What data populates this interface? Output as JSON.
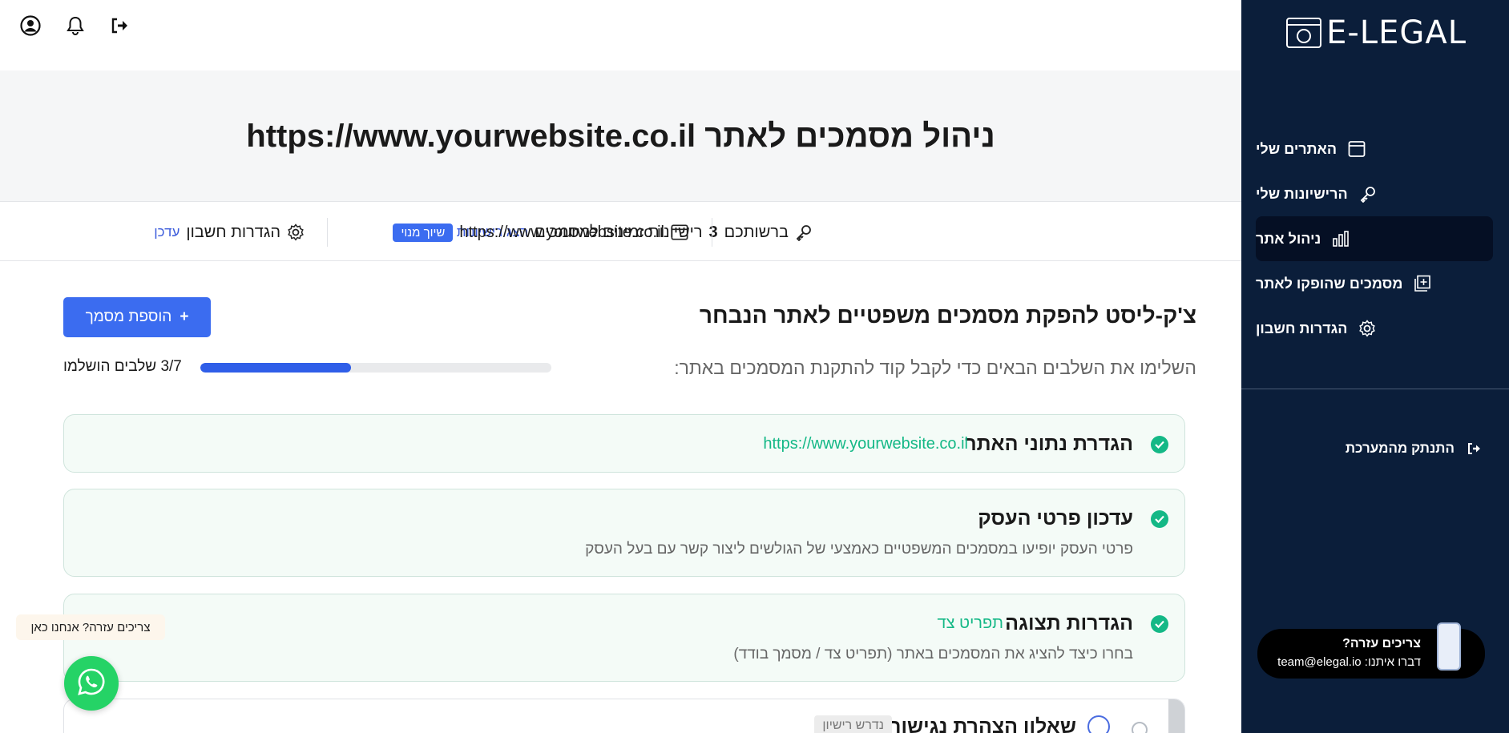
{
  "brand": {
    "logo_text": "E-LEGAL"
  },
  "sidebar": {
    "items": [
      {
        "label": "האתרים שלי",
        "icon": "browser-window-icon"
      },
      {
        "label": "הרישיונות שלי",
        "icon": "key-icon"
      },
      {
        "label": "ניהול אתר",
        "icon": "bar-chart-icon",
        "active": true
      },
      {
        "label": "מסמכים שהופקו לאתר",
        "icon": "document-plus-icon"
      },
      {
        "label": "הגדרות חשבון",
        "icon": "gear-icon"
      }
    ],
    "logout_label": "התנתק מהמערכת"
  },
  "help_card": {
    "title": "צריכים עזרה?",
    "email_line": "דברו איתנו: team@elegal.io"
  },
  "page": {
    "title": "ניהול מסמכים לאתר https://www.yourwebsite.co.il"
  },
  "info_row": {
    "licenses_prefix": "ברשותכם",
    "licenses_count": "3",
    "licenses_suffix": "רישיונות זמינים למסמכים",
    "show_licenses_link": "הצג רישיונות",
    "website_url": "https://www.yourwebsite.co.il",
    "assign_badge": "שיוך מנוי",
    "account_settings_label": "הגדרות חשבון",
    "update_link": "עדכן"
  },
  "checklist": {
    "title": "צ'ק-ליסט להפקת מסמכים משפטיים לאתר הנבחר",
    "subtitle": "השלימו את השלבים הבאים כדי לקבל קוד להתקנת המסמכים באתר:",
    "add_button_label": "הוספת מסמך",
    "progress_label": "3/7 שלבים הושלמו",
    "progress_fraction": 0.43,
    "steps": [
      {
        "title": "הגדרת נתוני האתר",
        "extra": "https://www.yourwebsite.co.il",
        "desc": ""
      },
      {
        "title": "עדכון פרטי העסק",
        "extra": "",
        "desc": "פרטי העסק יופיעו במסמכים המשפטיים כאמצעי של הגולשים ליצור קשר עם בעל העסק"
      },
      {
        "title": "הגדרות תצוגה",
        "extra": "תפריט צד",
        "desc": "בחרו כיצד להציג את המסמכים באתר (תפריט צד / מסמך בודד)"
      },
      {
        "title": "שאלון הצהרת נגישות",
        "badge": "נדרש רישיון"
      }
    ]
  },
  "chat_bubble": {
    "text": "צריכים עזרה? אנחנו כאן"
  },
  "colors": {
    "sidebar_bg": "#0b1e3a",
    "accent_blue": "#3b6cf0",
    "success_green": "#14b886"
  }
}
